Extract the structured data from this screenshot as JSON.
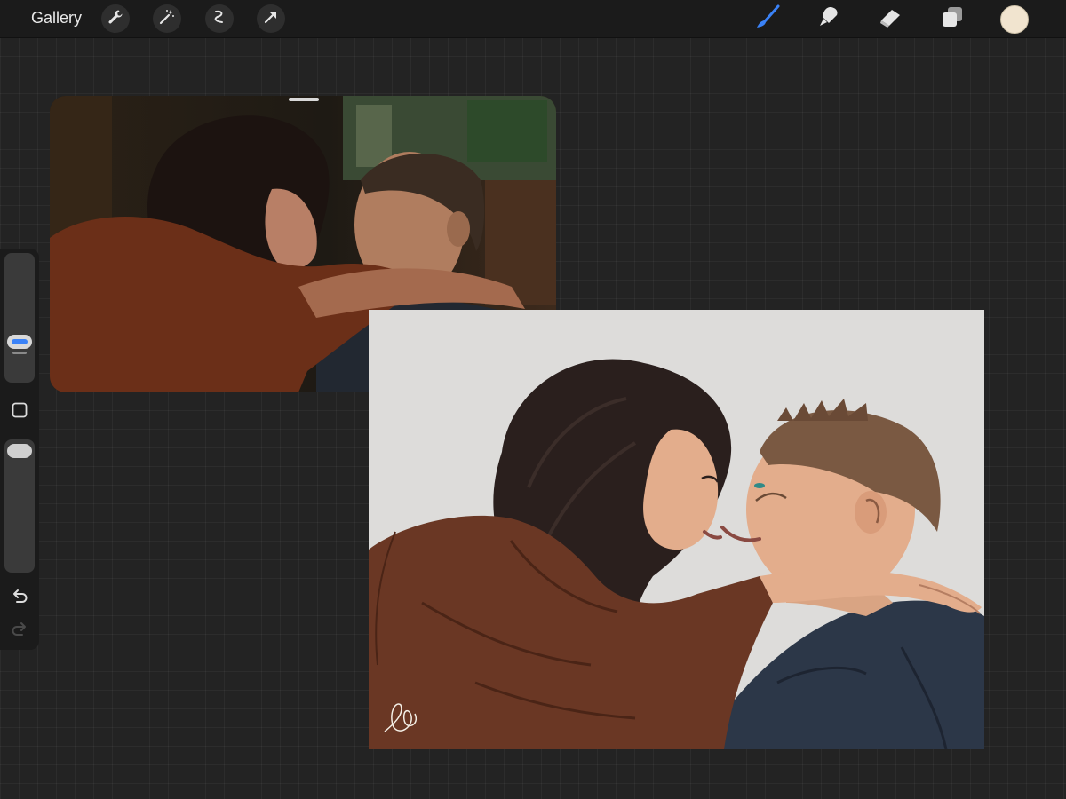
{
  "toolbar": {
    "gallery_label": "Gallery",
    "left_tools": [
      "wrench-icon",
      "magic-wand-icon",
      "selection-icon",
      "transform-arrow-icon"
    ],
    "right_tools": [
      "brush-icon",
      "smudge-icon",
      "eraser-icon",
      "layers-icon"
    ],
    "active_tool": "brush",
    "active_tool_color": "#3a82f7",
    "current_color": "#f1e4cf"
  },
  "sidebar": {
    "controls": [
      "brush-size-slider",
      "modify-button",
      "opacity-slider",
      "undo-button",
      "redo-button"
    ]
  },
  "reference": {
    "subject": "photo-couple-reference"
  },
  "canvas": {
    "background_color": "#dddcda",
    "signature": "signature-mark"
  },
  "colors": {
    "app_bg": "#232323",
    "bar_bg": "#1b1b1b",
    "jacket_rust": "#6a3724",
    "shirt_navy": "#2c3748",
    "hair_dark": "#2a1f1d",
    "skin": "#e3ad8c"
  }
}
